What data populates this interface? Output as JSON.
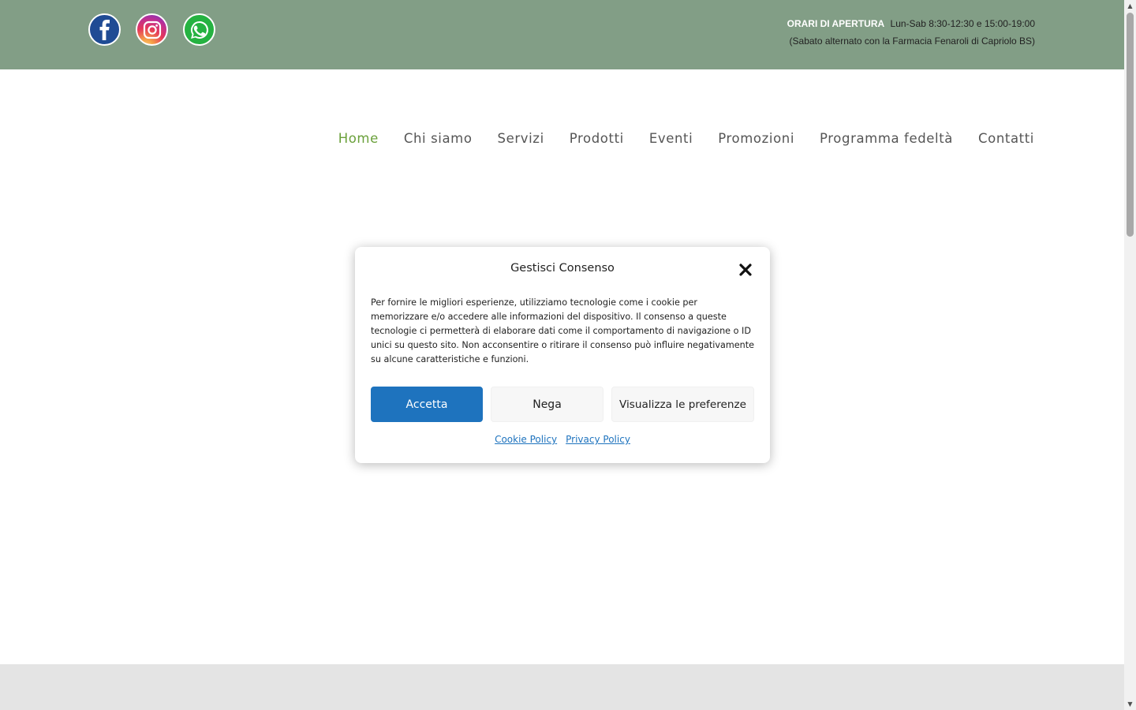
{
  "topbar": {
    "social": [
      {
        "name": "facebook-icon"
      },
      {
        "name": "instagram-icon"
      },
      {
        "name": "whatsapp-icon"
      }
    ],
    "hours_label": "ORARI DI APERTURA",
    "hours_value": "Lun-Sab 8:30-12:30 e 15:00-19:00",
    "hours_note": "(Sabato alternato con la Farmacia Fenaroli di Capriolo BS)"
  },
  "nav": {
    "items": [
      {
        "label": "Home",
        "active": true
      },
      {
        "label": "Chi siamo"
      },
      {
        "label": "Servizi"
      },
      {
        "label": "Prodotti"
      },
      {
        "label": "Eventi"
      },
      {
        "label": "Promozioni"
      },
      {
        "label": "Programma fedeltà"
      },
      {
        "label": "Contatti"
      }
    ]
  },
  "consent": {
    "title": "Gestisci Consenso",
    "text": "Per fornire le migliori esperienze, utilizziamo tecnologie come i cookie per memorizzare e/o accedere alle informazioni del dispositivo. Il consenso a queste tecnologie ci permetterà di elaborare dati come il comportamento di navigazione o ID unici su questo sito. Non acconsentire o ritirare il consenso può influire negativamente su alcune caratteristiche e funzioni.",
    "accept_label": "Accetta",
    "deny_label": "Nega",
    "prefs_label": "Visualizza le preferenze",
    "cookie_policy_label": "Cookie Policy",
    "privacy_policy_label": "Privacy Policy"
  },
  "colors": {
    "topbar_bg": "#829e86",
    "nav_active": "#6aa03a",
    "primary_button": "#1e73be",
    "footer_bg": "#e4e4e4"
  }
}
